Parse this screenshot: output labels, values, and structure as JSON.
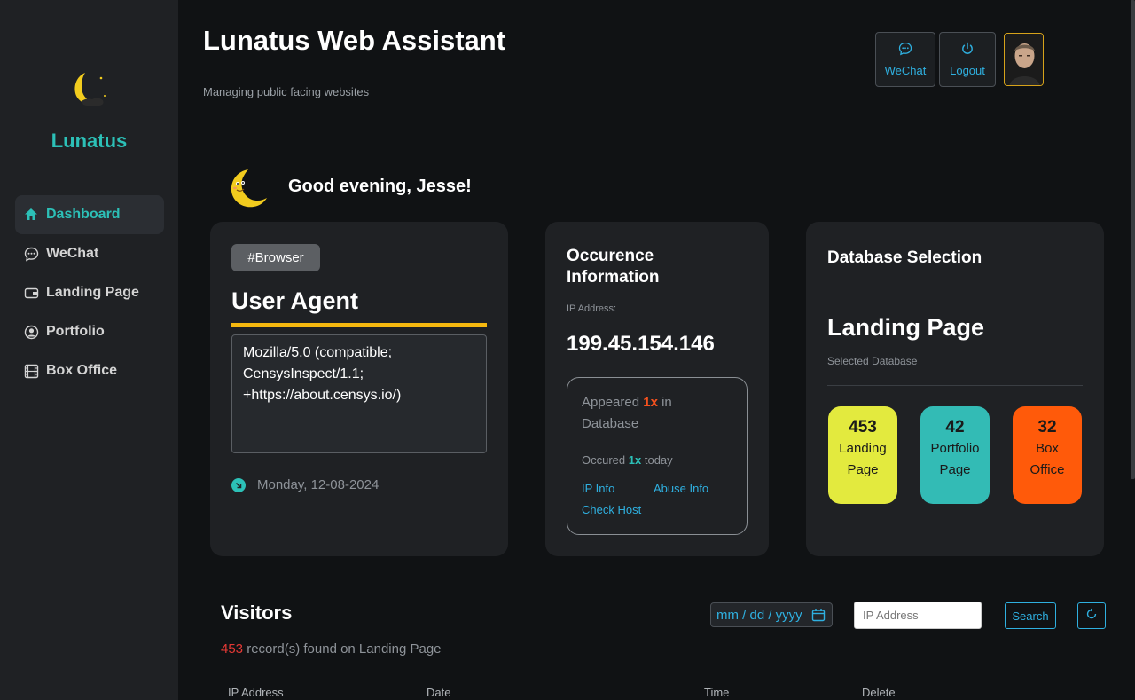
{
  "sidebar": {
    "brand": "Lunatus",
    "items": [
      {
        "label": "Dashboard",
        "icon": "home-icon",
        "active": true
      },
      {
        "label": "WeChat",
        "icon": "chat-icon"
      },
      {
        "label": "Landing Page",
        "icon": "wallet-icon"
      },
      {
        "label": "Portfolio",
        "icon": "user-circle-icon"
      },
      {
        "label": "Box Office",
        "icon": "film-icon"
      }
    ]
  },
  "header": {
    "title": "Lunatus Web Assistant",
    "subtitle": "Managing public facing websites",
    "wechat_label": "WeChat",
    "logout_label": "Logout"
  },
  "greeting": "Good evening, Jesse!",
  "user_agent": {
    "tag": "#Browser",
    "title": "User Agent",
    "value": "Mozilla/5.0 (compatible; CensysInspect/1.1; +https://about.censys.io/)",
    "date": "Monday, 12-08-2024"
  },
  "occurrence": {
    "title": "Occurence Information",
    "ip_label": "IP Address:",
    "ip": "199.45.154.146",
    "appeared_prefix": "Appeared",
    "appeared_count": "1x",
    "appeared_suffix": "in Database",
    "occured_prefix": "Occured",
    "occured_count": "1x",
    "occured_suffix": "today",
    "links": {
      "ip_info": "IP Info",
      "abuse_info": "Abuse Info",
      "check_host": "Check Host"
    }
  },
  "database": {
    "title": "Database Selection",
    "selected": "Landing Page",
    "selected_label": "Selected Database",
    "stats": [
      {
        "count": "453",
        "line1": "Landing",
        "line2": "Page",
        "color": "#e3ea3e"
      },
      {
        "count": "42",
        "line1": "Portfolio",
        "line2": "Page",
        "color": "#33bbb5"
      },
      {
        "count": "32",
        "line1": "Box",
        "line2": "Office",
        "color": "#ff5a0a"
      }
    ]
  },
  "visitors": {
    "title": "Visitors",
    "count": "453",
    "count_suffix": " record(s) found on Landing Page",
    "date_placeholder": "mm / dd / yyyy",
    "ip_placeholder": "IP Address",
    "search_label": "Search",
    "columns": [
      "IP Address",
      "Date",
      "Time",
      "Delete"
    ]
  },
  "colors": {
    "accent": "#2cc0b7",
    "link": "#2fb0e0",
    "highlight": "#f5b80f"
  }
}
